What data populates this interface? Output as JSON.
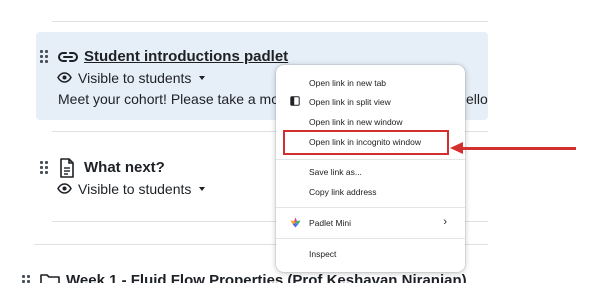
{
  "activities": [
    {
      "title": "Student introductions padlet",
      "visibility": "Visible to students",
      "description_start": "Meet your cohort! Please take a mome",
      "description_end": "ello"
    },
    {
      "title": "What next?",
      "visibility": "Visible to students"
    }
  ],
  "section": {
    "title": "Week 1 - Fluid Flow Properties (Prof Keshavan Niranjan)"
  },
  "context_menu": {
    "items": [
      {
        "label": "Open link in new tab"
      },
      {
        "label": "Open link in split view",
        "icon": "split-view-icon"
      },
      {
        "label": "Open link in new window"
      },
      {
        "label": "Open link in incognito window"
      },
      {
        "label": "Save link as..."
      },
      {
        "label": "Copy link address"
      },
      {
        "label": "Padlet Mini",
        "icon": "padlet-mini-icon"
      },
      {
        "label": "Inspect"
      }
    ]
  },
  "colors": {
    "highlight_bg": "#e6eef8",
    "annotation_red": "#d32f2f"
  }
}
